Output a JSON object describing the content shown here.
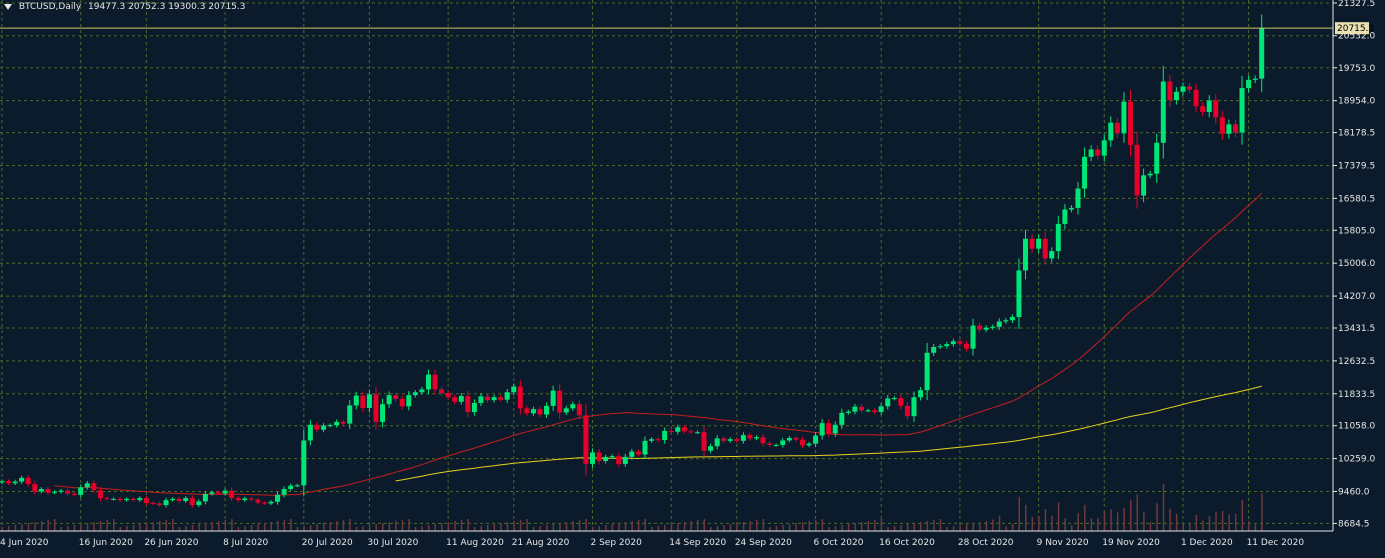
{
  "header": {
    "symbol": "BTCUSD,Daily",
    "ohlc": "19477.3 20752.3 19300.3 20715.3"
  },
  "colors": {
    "background": "#0c1b2b",
    "grid": "#4a6a2a",
    "axis_text": "#e6e6e6",
    "bull": "#00e676",
    "bear": "#e6002a",
    "ma_fast": "#c81e1e",
    "ma_slow": "#e6d21e",
    "volume": "#6e3a3a",
    "price_line": "#c8c864",
    "price_tag_bg": "#e8e0b0"
  },
  "current_price_label": "20715.3",
  "chart_data": {
    "type": "candlestick",
    "title": "BTCUSD,Daily",
    "ylim": [
      8500,
      21400
    ],
    "y_ticks": [
      "21327.5",
      "20532.0",
      "19753.0",
      "18954.0",
      "18178.5",
      "17379.5",
      "16580.5",
      "15805.0",
      "15006.0",
      "14207.0",
      "13431.5",
      "12632.5",
      "11833.5",
      "11058.0",
      "10259.0",
      "9460.0",
      "8684.5"
    ],
    "x_ticks": [
      {
        "label": "4 Jun 2020",
        "day": 0
      },
      {
        "label": "16 Jun 2020",
        "day": 12
      },
      {
        "label": "26 Jun 2020",
        "day": 22
      },
      {
        "label": "8 Jul 2020",
        "day": 34
      },
      {
        "label": "20 Jul 2020",
        "day": 46
      },
      {
        "label": "30 Jul 2020",
        "day": 56
      },
      {
        "label": "11 Aug 2020",
        "day": 68
      },
      {
        "label": "21 Aug 2020",
        "day": 78
      },
      {
        "label": "2 Sep 2020",
        "day": 90
      },
      {
        "label": "14 Sep 2020",
        "day": 102
      },
      {
        "label": "24 Sep 2020",
        "day": 112
      },
      {
        "label": "6 Oct 2020",
        "day": 124
      },
      {
        "label": "16 Oct 2020",
        "day": 134
      },
      {
        "label": "28 Oct 2020",
        "day": 146
      },
      {
        "label": "9 Nov 2020",
        "day": 158
      },
      {
        "label": "19 Nov 2020",
        "day": 168
      },
      {
        "label": "1 Dec 2020",
        "day": 180
      },
      {
        "label": "11 Dec 2020",
        "day": 190
      }
    ],
    "close": [
      9710,
      9660,
      9700,
      9790,
      9640,
      9460,
      9520,
      9430,
      9450,
      9480,
      9410,
      9380,
      9560,
      9660,
      9490,
      9300,
      9280,
      9280,
      9250,
      9280,
      9250,
      9300,
      9180,
      9170,
      9130,
      9250,
      9280,
      9230,
      9300,
      9130,
      9220,
      9400,
      9440,
      9410,
      9480,
      9300,
      9250,
      9290,
      9260,
      9190,
      9170,
      9210,
      9380,
      9520,
      9600,
      9610,
      10700,
      11080,
      10960,
      11060,
      11070,
      11150,
      11110,
      11550,
      11790,
      11490,
      11820,
      11150,
      11580,
      11800,
      11710,
      11530,
      11800,
      11870,
      11940,
      12300,
      11940,
      11850,
      11750,
      11640,
      11780,
      11390,
      11610,
      11770,
      11680,
      11750,
      11690,
      11870,
      12010,
      11480,
      11360,
      11460,
      11330,
      11540,
      11910,
      11380,
      11480,
      11580,
      11310,
      10130,
      10410,
      10200,
      10300,
      10320,
      10130,
      10300,
      10430,
      10360,
      10690,
      10730,
      10710,
      10930,
      10910,
      11020,
      10920,
      10900,
      10900,
      10450,
      10560,
      10750,
      10690,
      10730,
      10690,
      10830,
      10750,
      10780,
      10630,
      10590,
      10590,
      10700,
      10760,
      10720,
      10580,
      10620,
      10820,
      11120,
      10870,
      11080,
      11370,
      11400,
      11520,
      11430,
      11430,
      11390,
      11530,
      11720,
      11730,
      11540,
      11290,
      11750,
      11920,
      12830,
      12970,
      12990,
      13040,
      13110,
      13050,
      12930,
      13490,
      13390,
      13440,
      13460,
      13590,
      13620,
      13700,
      14830,
      15600,
      15360,
      15600,
      15120,
      15300,
      15960,
      16310,
      16350,
      16820,
      17590,
      17770,
      17620,
      17990,
      18420,
      18160,
      18930,
      17880,
      16650,
      17140,
      17180,
      17930,
      19420,
      18970,
      19170,
      19300,
      19220,
      18820,
      18680,
      18960,
      18550,
      18150,
      18380,
      18180,
      19260,
      19460,
      19490,
      20715
    ],
    "ma_fast_label": "MA (red)",
    "ma_slow_label": "MA (yellow)"
  }
}
